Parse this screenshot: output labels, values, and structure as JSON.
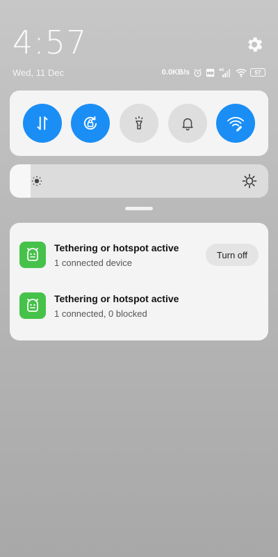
{
  "status_bar": {
    "time": "4:57",
    "date": "Wed, 11 Dec",
    "network_speed": "0.0KB/s",
    "network_type": "4G",
    "battery_level": "57"
  },
  "quick_toggles": [
    {
      "name": "mobile-data",
      "icon": "data-arrows-icon",
      "state": "on"
    },
    {
      "name": "auto-rotate",
      "icon": "rotate-lock-icon",
      "state": "on"
    },
    {
      "name": "flashlight",
      "icon": "flashlight-icon",
      "state": "off"
    },
    {
      "name": "silent",
      "icon": "bell-icon",
      "state": "off"
    },
    {
      "name": "hotspot",
      "icon": "wifi-hotspot-icon",
      "state": "on"
    }
  ],
  "brightness": {
    "level": 0.08
  },
  "notifications": [
    {
      "app_icon": "tether-robot-icon",
      "title": "Tethering or hotspot active",
      "subtitle": "1 connected device",
      "action_label": "Turn off"
    },
    {
      "app_icon": "tether-robot-icon",
      "title": "Tethering or hotspot active",
      "subtitle": "1 connected, 0 blocked"
    }
  ],
  "colors": {
    "accent": "#1a8ef5",
    "toggle_off": "#dedede",
    "app_green": "#46c24a"
  }
}
